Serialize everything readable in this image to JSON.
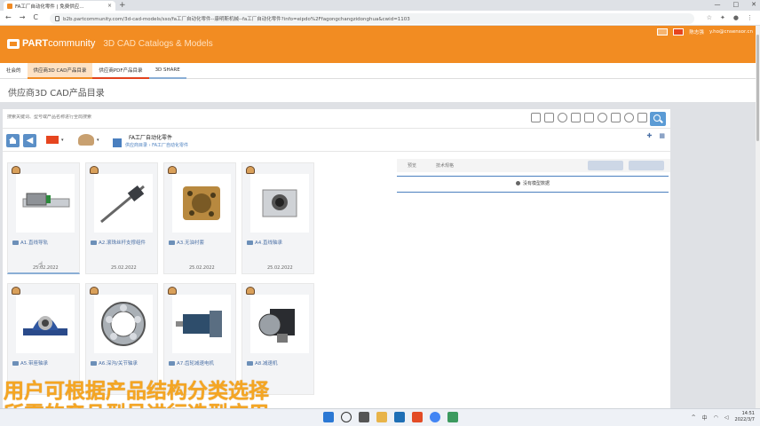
{
  "browser": {
    "tab_title": "FA工厂自动化零件 | 免费供应...",
    "tab_close": "×",
    "new_tab": "+",
    "window_controls": [
      "—",
      "□",
      "✕"
    ],
    "url": "b2b.partcommunity.com/3d-cad-models/sso/fa工厂自动化零件--康明斯机械--fa工厂自动化零件?info=eipdo%2Ffagongchangzidonghua&cwid=1103",
    "nav": [
      "←",
      "→",
      "C"
    ]
  },
  "header": {
    "brand_bold": "PART",
    "brand_rest": "community",
    "tagline": "3D CAD Catalogs & Models",
    "user_name": "陈志强",
    "user_email": "y.ho@cnsensor.cn"
  },
  "nav_tabs": [
    "社会的",
    "供应商3D CAD产品目录",
    "供应商PDF产品目录",
    "3D SHARE"
  ],
  "page_title": "供应商3D CAD产品目录",
  "search": {
    "placeholder": "搜索关键词、型号或产品名称进行全局搜索"
  },
  "toolbar": {
    "back": "◀",
    "caret": "▾",
    "breadcrumb_title": "FA工厂自动化零件",
    "breadcrumb_path": "供应商目录 › FA工厂自动化零件",
    "pin": "✚",
    "grid_toggle": "▦"
  },
  "products": [
    {
      "label": "A1.直线导轨",
      "date": "25.02.2022"
    },
    {
      "label": "A2.滚珠丝杆支撑组件",
      "date": "25.02.2022"
    },
    {
      "label": "A3.无油衬套",
      "date": "25.02.2022"
    },
    {
      "label": "A4.直线轴承",
      "date": "25.02.2022"
    },
    {
      "label": "A5.带座轴承",
      "date": ""
    },
    {
      "label": "A6.深沟/关节轴承",
      "date": ""
    },
    {
      "label": "A7.齿轮减速电机",
      "date": ""
    },
    {
      "label": "A8.减速机",
      "date": ""
    }
  ],
  "preview": {
    "tab1": "预览",
    "tab2": "技术规格",
    "empty_message": "没有模型数据"
  },
  "caption": {
    "line1": "用户可根据产品结构分类选择",
    "line2": "所需的产品型号进行选型应用"
  },
  "taskbar": {
    "lang": "中",
    "time": "14:51",
    "date": "2022/3/7"
  },
  "colors": {
    "brand_orange": "#f28c22",
    "caption": "#f5a623",
    "link_blue": "#4a6fa5"
  }
}
